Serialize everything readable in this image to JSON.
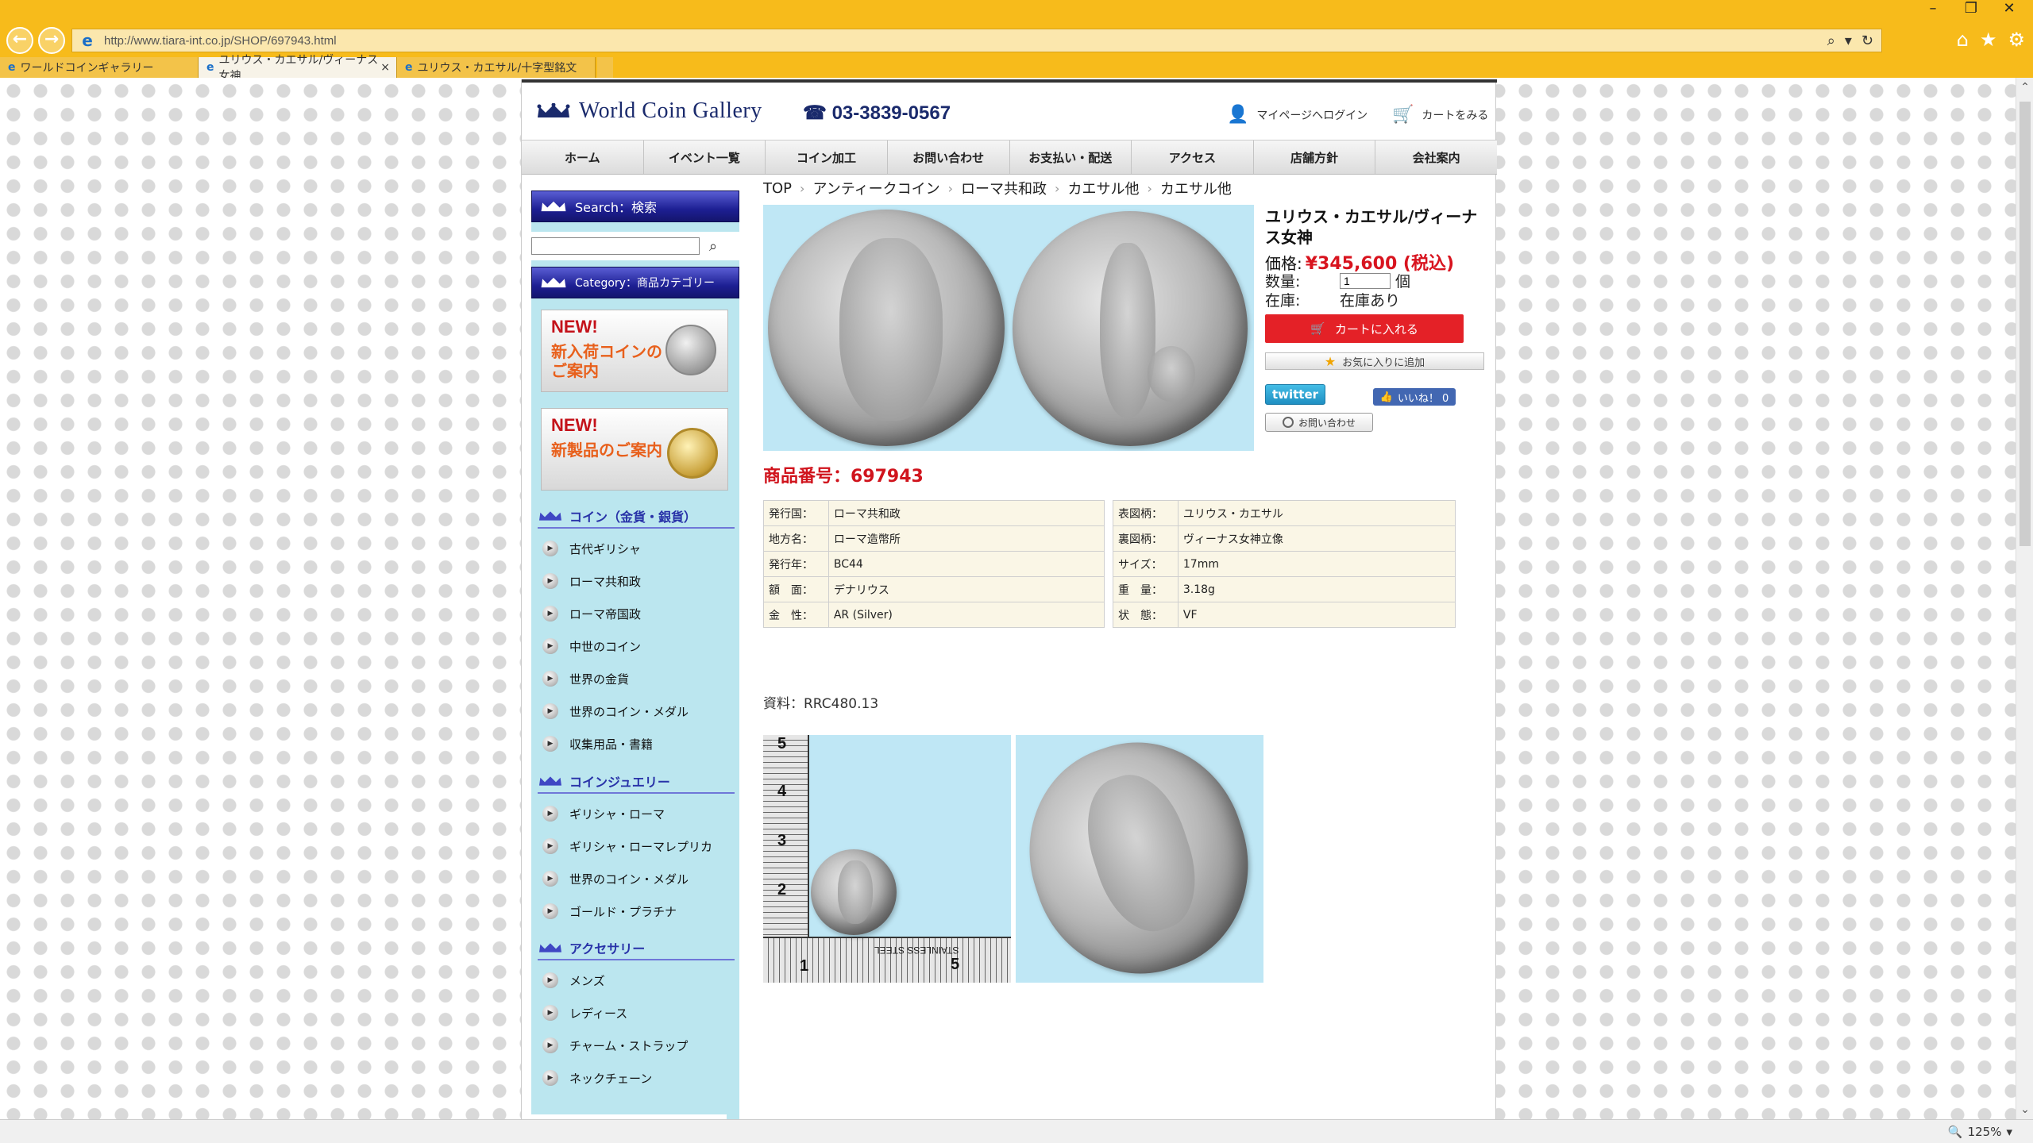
{
  "browser": {
    "url": "http://www.tiara-int.co.jp/SHOP/697943.html",
    "tabs": [
      {
        "label": "ワールドコインギャラリー",
        "active": false
      },
      {
        "label": "ユリウス・カエサル/ヴィーナス女神",
        "active": true
      },
      {
        "label": "ユリウス・カエサル/十字型銘文",
        "active": false
      }
    ],
    "zoom": "125%",
    "tab_close": "×"
  },
  "header": {
    "logo": "World Coin Gallery",
    "phone": "03-3839-0567",
    "mypage": "マイページへログイン",
    "cart": "カートをみる"
  },
  "gnav": [
    "ホーム",
    "イベント一覧",
    "コイン加工",
    "お問い合わせ",
    "お支払い・配送",
    "アクセス",
    "店舗方針",
    "会社案内"
  ],
  "sidebar": {
    "search_head": "Search：検索",
    "search_placeholder": "",
    "category_head": "Category：商品カテゴリー",
    "banner1": {
      "new": "NEW!",
      "text": "新入荷コインのご案内"
    },
    "banner2": {
      "new": "NEW!",
      "text": "新製品のご案内"
    },
    "groups": [
      {
        "title": "コイン（金貨・銀貨）",
        "items": [
          "古代ギリシャ",
          "ローマ共和政",
          "ローマ帝国政",
          "中世のコイン",
          "世界の金貨",
          "世界のコイン・メダル",
          "収集用品・書籍"
        ]
      },
      {
        "title": "コインジュエリー",
        "items": [
          "ギリシャ・ローマ",
          "ギリシャ・ローマレプリカ",
          "世界のコイン・メダル",
          "ゴールド・プラチナ"
        ]
      },
      {
        "title": "アクセサリー",
        "items": [
          "メンズ",
          "レディース",
          "チャーム・ストラップ",
          "ネックチェーン"
        ]
      }
    ]
  },
  "breadcrumb": [
    "TOP",
    "アンティークコイン",
    "ローマ共和政",
    "カエサル他",
    "カエサル他"
  ],
  "product": {
    "title": "ユリウス・カエサル/ヴィーナス女神",
    "price_label": "価格:",
    "price": "¥345,600 (税込)",
    "qty_label": "数量:",
    "qty_value": "1",
    "qty_unit": "個",
    "stock_label": "在庫:",
    "stock_value": "在庫あり",
    "add_cart": "カートに入れる",
    "favorite": "お気に入りに追加",
    "twitter": "twitter",
    "like": "いいね！ 0",
    "inquiry": "お問い合わせ",
    "code": "商品番号：697943",
    "specs_left": [
      {
        "k": "発行国：",
        "v": "ローマ共和政"
      },
      {
        "k": "地方名：",
        "v": "ローマ造幣所"
      },
      {
        "k": "発行年：",
        "v": "BC44"
      },
      {
        "k": "額　面：",
        "v": "デナリウス"
      },
      {
        "k": "金　性：",
        "v": "AR (Silver)"
      }
    ],
    "specs_right": [
      {
        "k": "表図柄：",
        "v": "ユリウス・カエサル"
      },
      {
        "k": "裏図柄：",
        "v": "ヴィーナス女神立像"
      },
      {
        "k": "サイズ：",
        "v": "17mm"
      },
      {
        "k": "重　量：",
        "v": "3.18g"
      },
      {
        "k": "状　態：",
        "v": "VF"
      }
    ],
    "reference": "資料：RRC480.13",
    "ruler": {
      "n5": "5",
      "n4": "4",
      "n3": "3",
      "n2": "2",
      "n1": "1",
      "steel": "STAINLESS STEEL"
    }
  },
  "colors": {
    "chrome": "#f7bb1b",
    "sidebar": "#bbe6ef",
    "price": "#d8141f",
    "cart_button": "#e42127"
  }
}
